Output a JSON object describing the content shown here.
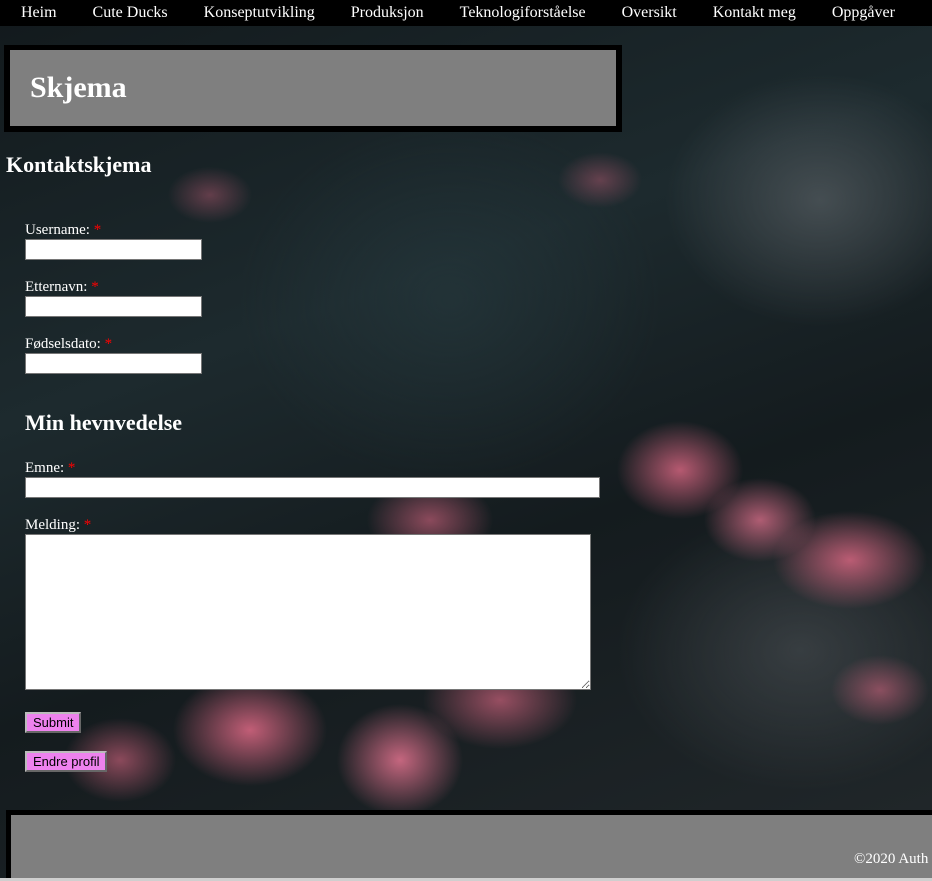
{
  "nav": {
    "items": [
      "Heim",
      "Cute Ducks",
      "Konseptutvikling",
      "Produksjon",
      "Teknologiforståelse",
      "Oversikt",
      "Kontakt meg",
      "Oppgåver"
    ]
  },
  "header": {
    "title": "Skjema"
  },
  "form": {
    "title": "Kontaktskjema",
    "required_marker": "*",
    "username_label": "Username:",
    "username_value": "",
    "etternavn_label": "Etternavn:",
    "etternavn_value": "",
    "fodselsdato_label": "Fødselsdato:",
    "fodselsdato_value": "",
    "section_title": "Min hevnvedelse",
    "emne_label": "Emne:",
    "emne_value": "",
    "melding_label": "Melding:",
    "melding_value": "",
    "submit_label": "Submit",
    "endre_label": "Endre profil"
  },
  "footer": {
    "copyright": "©2020 Auth"
  },
  "colors": {
    "button_bg": "#ee82ee",
    "header_bg": "#7f7f7f",
    "required": "#ff0000"
  }
}
